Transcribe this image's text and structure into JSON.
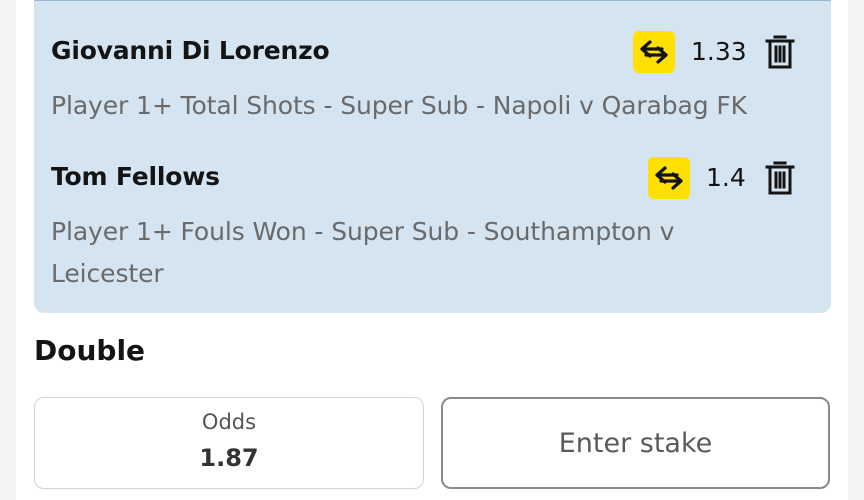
{
  "selections": [
    {
      "name": "Giovanni Di Lorenzo",
      "odds": "1.33",
      "market_line1": "Player 1+ Total Shots - Super Sub - Napoli v Qarabag FK",
      "market_line2": ""
    },
    {
      "name": "Tom Fellows",
      "odds": "1.4",
      "market_line1": "Player 1+ Fouls Won - Super Sub - Southampton v",
      "market_line2": "Leicester"
    }
  ],
  "bet": {
    "title": "Double",
    "odds_label": "Odds",
    "odds_value": "1.87",
    "stake_placeholder": "Enter stake"
  },
  "icons": {
    "swap": "swap-arrows-icon",
    "delete": "trash-icon"
  },
  "colors": {
    "selection_bg": "#d4e4f1",
    "swap_bg": "#ffe000"
  }
}
